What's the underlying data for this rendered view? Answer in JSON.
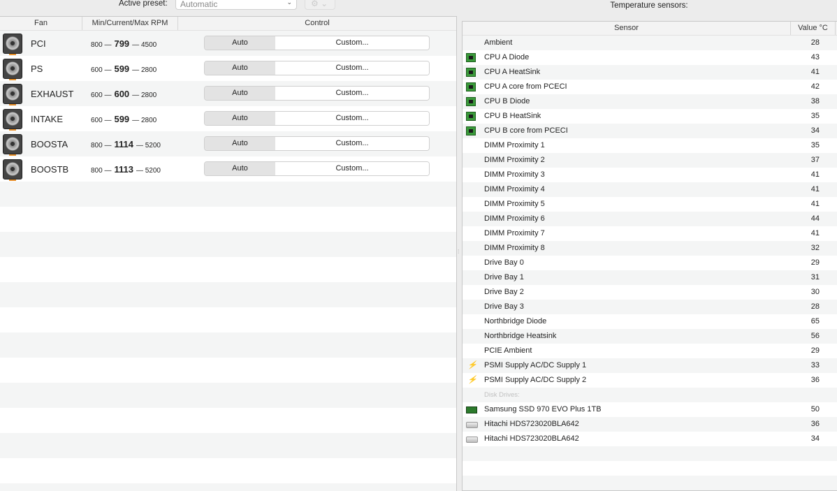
{
  "preset": {
    "label": "Active preset:",
    "value": "Automatic",
    "gear": "⚙ ⌄"
  },
  "fans": {
    "headers": [
      "Fan",
      "Min/Current/Max RPM",
      "Control"
    ],
    "rows": [
      {
        "name": "PCI",
        "min": "800",
        "cur": "799",
        "max": "4500"
      },
      {
        "name": "PS",
        "min": "600",
        "cur": "599",
        "max": "2800"
      },
      {
        "name": "EXHAUST",
        "min": "600",
        "cur": "600",
        "max": "2800"
      },
      {
        "name": "INTAKE",
        "min": "600",
        "cur": "599",
        "max": "2800"
      },
      {
        "name": "BOOSTA",
        "min": "800",
        "cur": "1114",
        "max": "5200"
      },
      {
        "name": "BOOSTB",
        "min": "800",
        "cur": "1113",
        "max": "5200"
      }
    ],
    "auto_label": "Auto",
    "custom_label": "Custom...",
    "dash": "—"
  },
  "sensors": {
    "title": "Temperature sensors:",
    "headers": [
      "Sensor",
      "Value °C"
    ],
    "rows": [
      {
        "icon": "none",
        "name": "Ambient",
        "value": "28"
      },
      {
        "icon": "chip",
        "name": "CPU A Diode",
        "value": "43"
      },
      {
        "icon": "chip",
        "name": "CPU A HeatSink",
        "value": "41"
      },
      {
        "icon": "chip",
        "name": "CPU A core from PCECI",
        "value": "42"
      },
      {
        "icon": "chip",
        "name": "CPU B Diode",
        "value": "38"
      },
      {
        "icon": "chip",
        "name": "CPU B HeatSink",
        "value": "35"
      },
      {
        "icon": "chip",
        "name": "CPU B core from PCECI",
        "value": "34"
      },
      {
        "icon": "none",
        "name": "DIMM Proximity 1",
        "value": "35"
      },
      {
        "icon": "none",
        "name": "DIMM Proximity 2",
        "value": "37"
      },
      {
        "icon": "none",
        "name": "DIMM Proximity 3",
        "value": "41"
      },
      {
        "icon": "none",
        "name": "DIMM Proximity 4",
        "value": "41"
      },
      {
        "icon": "none",
        "name": "DIMM Proximity 5",
        "value": "41"
      },
      {
        "icon": "none",
        "name": "DIMM Proximity 6",
        "value": "44"
      },
      {
        "icon": "none",
        "name": "DIMM Proximity 7",
        "value": "41"
      },
      {
        "icon": "none",
        "name": "DIMM Proximity 8",
        "value": "32"
      },
      {
        "icon": "none",
        "name": "Drive Bay 0",
        "value": "29"
      },
      {
        "icon": "none",
        "name": "Drive Bay 1",
        "value": "31"
      },
      {
        "icon": "none",
        "name": "Drive Bay 2",
        "value": "30"
      },
      {
        "icon": "none",
        "name": "Drive Bay 3",
        "value": "28"
      },
      {
        "icon": "none",
        "name": "Northbridge Diode",
        "value": "65"
      },
      {
        "icon": "none",
        "name": "Northbridge Heatsink",
        "value": "56"
      },
      {
        "icon": "none",
        "name": "PCIE Ambient",
        "value": "29"
      },
      {
        "icon": "bolt",
        "name": "PSMI Supply AC/DC Supply 1",
        "value": "33"
      },
      {
        "icon": "bolt",
        "name": "PSMI Supply AC/DC Supply 2",
        "value": "36"
      },
      {
        "icon": "section",
        "name": "Disk Drives:",
        "value": ""
      },
      {
        "icon": "ssd",
        "name": "Samsung SSD 970 EVO Plus 1TB",
        "value": "50"
      },
      {
        "icon": "hdd",
        "name": "Hitachi HDS723020BLA642",
        "value": "36"
      },
      {
        "icon": "hdd",
        "name": "Hitachi HDS723020BLA642",
        "value": "34"
      }
    ]
  }
}
